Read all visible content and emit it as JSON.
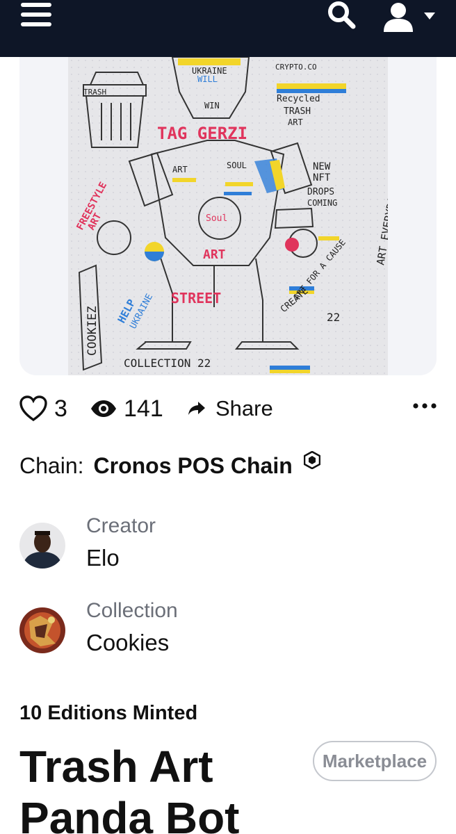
{
  "header": {
    "menu_icon": "hamburger-menu-icon",
    "search_icon": "search-icon",
    "user_icon": "user-account-icon",
    "dropdown_icon": "caret-down-icon",
    "background": "#0e1627"
  },
  "artwork": {
    "texts": {
      "ukraine": "UKRAINE",
      "will": "WILL",
      "win": "WIN",
      "crypto": "CRYPTO.CO",
      "trash": "TRASH",
      "recycled": "Recycled",
      "trash2": "TRASH",
      "art_label": "ART",
      "tag": "TAG GERZI",
      "new": "NEW",
      "nft": "NFT",
      "drops": "DROPS",
      "coming": "COMING",
      "freestyle": "FREESTYLE",
      "art2": "ART",
      "art3": "ART",
      "soul": "SOUL",
      "soul2": "Soul",
      "art4": "ART",
      "street": "STREET",
      "create": "CREATE",
      "art_for": "ART FOR A CAUSE",
      "help": "HELP",
      "ukraine2": "UKRAINE",
      "cookiez": "COOKIEZ",
      "collection": "COLLECTION 22",
      "twenty_two": "22",
      "art_every": "ART EVERYDAY"
    }
  },
  "stats": {
    "like_icon": "heart-icon",
    "likes": "3",
    "view_icon": "eye-icon",
    "views": "141",
    "share_icon": "share-arrow-icon",
    "share_label": "Share",
    "more_icon": "more-options-icon"
  },
  "chain": {
    "label": "Chain:",
    "value": "Cronos POS Chain",
    "icon": "cronos-hexagon-icon"
  },
  "creator": {
    "label": "Creator",
    "name": "Elo"
  },
  "collection": {
    "label": "Collection",
    "name": "Cookies"
  },
  "editions": "10 Editions Minted",
  "title": "Trash Art Panda Bot",
  "marketplace_button": "Marketplace"
}
